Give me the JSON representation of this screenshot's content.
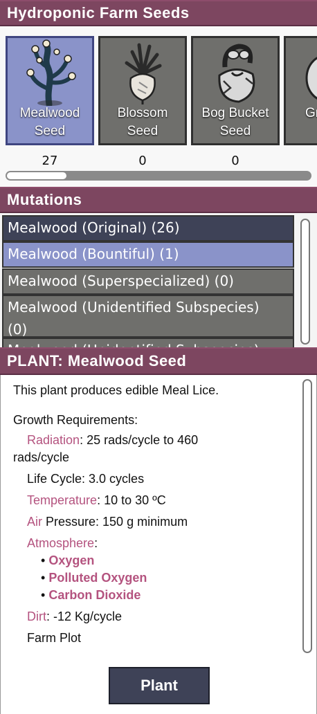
{
  "seeds_header": "Hydroponic Farm Seeds",
  "seeds": [
    {
      "name_line1": "Mealwood",
      "name_line2": "Seed",
      "count": "27",
      "selected": true,
      "icon": "mealwood-plant-icon"
    },
    {
      "name_line1": "Blossom",
      "name_line2": "Seed",
      "count": "0",
      "selected": false,
      "icon": "blossom-plant-icon"
    },
    {
      "name_line1": "Bog Bucket",
      "name_line2": "Seed",
      "count": "0",
      "selected": false,
      "icon": "bog-bucket-plant-icon"
    },
    {
      "name_line1": "Gr",
      "name_line2": "",
      "count": "",
      "selected": false,
      "icon": "garlic-plant-icon"
    }
  ],
  "mutations_header": "Mutations",
  "mutations": [
    {
      "label": "Mealwood (Original) (26)"
    },
    {
      "label": "Mealwood (Bountiful) (1)"
    },
    {
      "label": "Mealwood (Superspecialized) (0)"
    },
    {
      "label_line1": "Mealwood (Unidentified Subspecies)",
      "label_line2": "(0)"
    },
    {
      "label": "Mealwood (Unidentified Subspecies)"
    }
  ],
  "plant_header": "PLANT: Mealwood Seed",
  "plant": {
    "description": "This plant produces edible Meal Lice.",
    "growth_title": "Growth Requirements",
    "growth_colon": ":",
    "radiation_label": "Radiation",
    "radiation_value": ": 25 rads/cycle to 460",
    "radiation_value2": "rads/cycle",
    "life_cycle": "Life Cycle: 3.0 cycles",
    "temperature_label": "Temperature",
    "temperature_value": ": 10 to 30 ºC",
    "air_label": "Air",
    "pressure_value": " Pressure: 150 g minimum",
    "atmosphere_label": "Atmosphere",
    "atmosphere_colon": ":",
    "bullet": "•",
    "gases": [
      "Oxygen",
      "Polluted Oxygen",
      "Carbon Dioxide"
    ],
    "dirt_label": "Dirt",
    "dirt_value": ": -12 Kg/cycle",
    "farm_plot": "Farm Plot"
  },
  "plant_button": "Plant",
  "colors": {
    "header": "#7d4660",
    "selected": "#8a93c9",
    "card": "#6f6f6c",
    "highlight_text": "#b4537f",
    "button": "#3e4257"
  }
}
